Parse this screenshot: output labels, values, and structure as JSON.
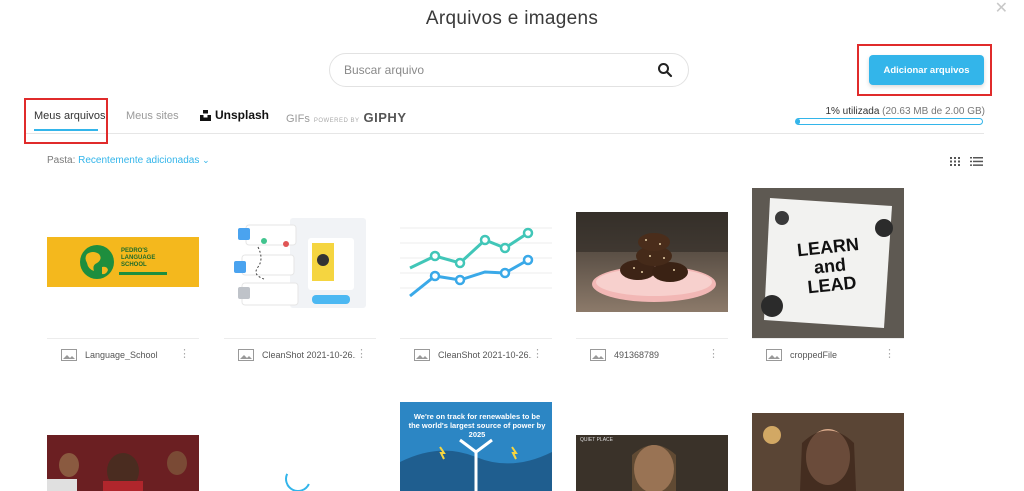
{
  "header": {
    "title": "Arquivos e imagens"
  },
  "search": {
    "placeholder": "Buscar arquivo"
  },
  "actions": {
    "add_label": "Adicionar arquivos"
  },
  "tabs": {
    "my_files": "Meus arquivos",
    "my_sites": "Meus sites",
    "unsplash": "Unsplash",
    "gifs": "GIFs",
    "powered_by": "POWERED BY",
    "giphy": "GIPHY"
  },
  "storage": {
    "used_label": "1% utilizada",
    "detail": "(20.63 MB de 2.00 GB)",
    "used_fraction": 0.01
  },
  "folder": {
    "label": "Pasta:",
    "value": "Recentemente adicionadas"
  },
  "files": [
    {
      "name": "Language_School",
      "logo_text": "PEDRO'S LANGUAGE SCHOOL"
    },
    {
      "name": "CleanShot 2021-10-26..."
    },
    {
      "name": "CleanShot 2021-10-26..."
    },
    {
      "name": "491368789"
    },
    {
      "name": "croppedFile",
      "art_text": "LEARN and LEAD"
    }
  ],
  "row2": {
    "poster_text": "We're on track for renewables to be the world's largest source of power by 2025",
    "scene_text": "QUIET PLACE"
  },
  "colors": {
    "accent": "#33b5ea",
    "highlight_box": "#e02b2b"
  }
}
